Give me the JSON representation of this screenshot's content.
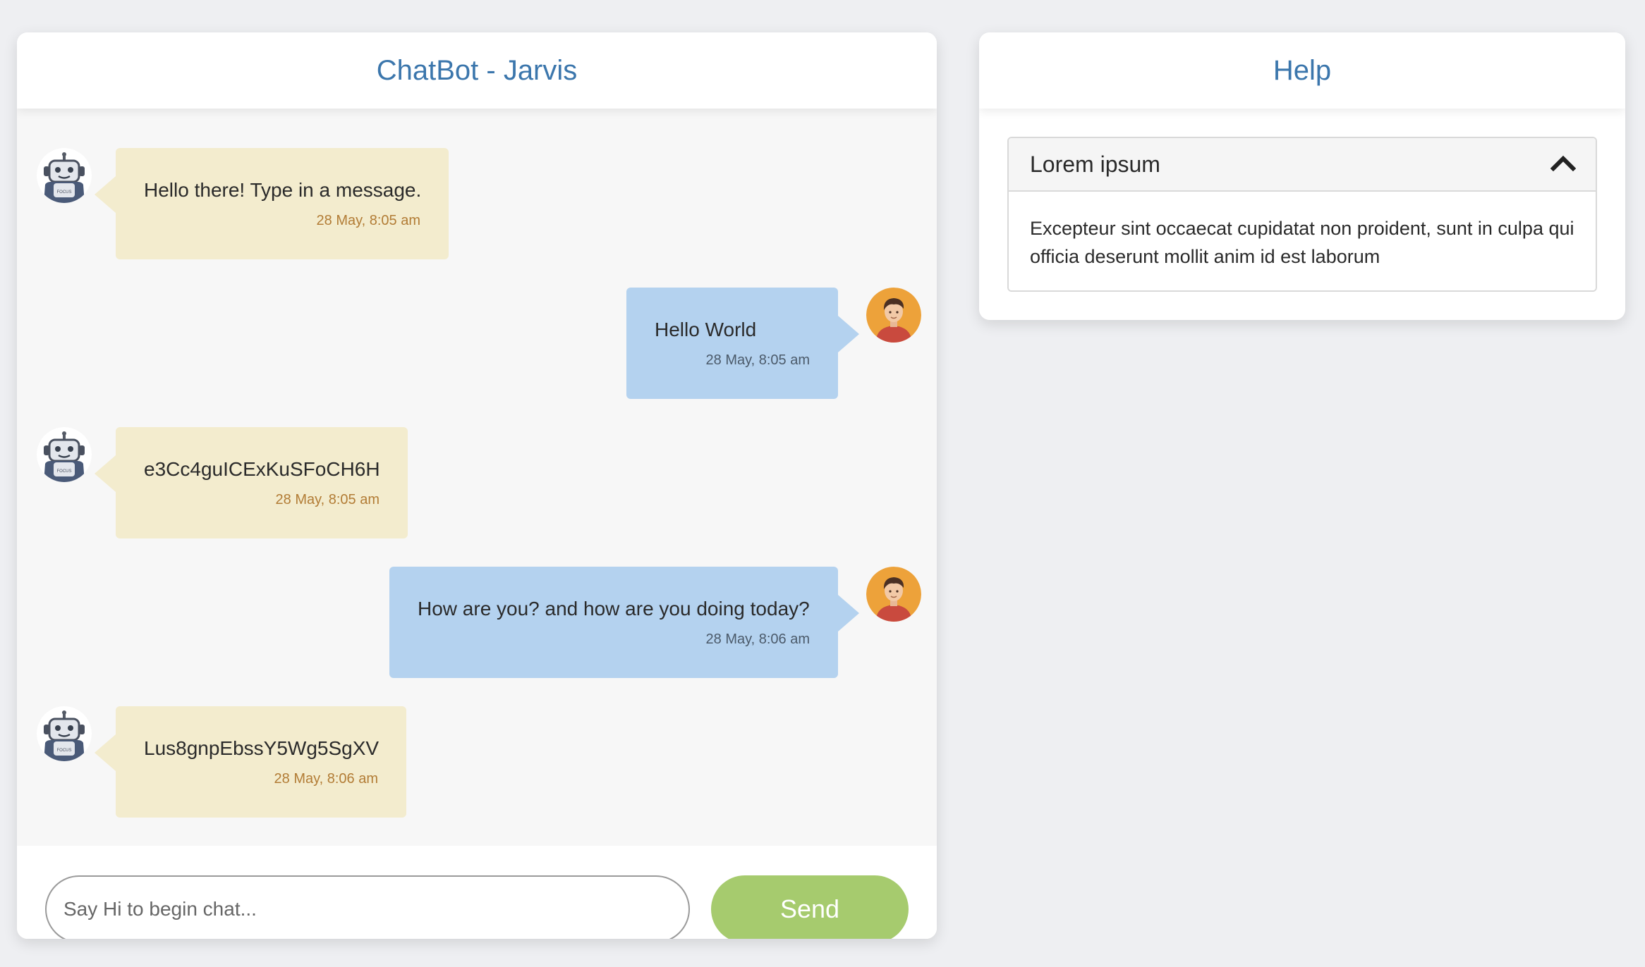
{
  "chat": {
    "title": "ChatBot - Jarvis",
    "messages": [
      {
        "sender": "bot",
        "text": "Hello there! Type in a message.",
        "time": "28 May, 8:05 am"
      },
      {
        "sender": "user",
        "text": "Hello World",
        "time": "28 May, 8:05 am"
      },
      {
        "sender": "bot",
        "text": "e3Cc4guICExKuSFoCH6H",
        "time": "28 May, 8:05 am"
      },
      {
        "sender": "user",
        "text": "How are you? and how are you doing today?",
        "time": "28 May, 8:06 am"
      },
      {
        "sender": "bot",
        "text": "Lus8gnpEbssY5Wg5SgXV",
        "time": "28 May, 8:06 am"
      }
    ],
    "input_placeholder": "Say Hi to begin chat...",
    "input_value": "",
    "send_label": "Send"
  },
  "help": {
    "title": "Help",
    "accordion": {
      "title": "Lorem ipsum",
      "expanded": true,
      "content": "Excepteur sint occaecat cupidatat non proident, sunt in culpa qui officia deserunt mollit anim id est laborum"
    }
  },
  "colors": {
    "title": "#3b76ac",
    "bot_bubble": "#f3ecce",
    "user_bubble": "#b4d2ef",
    "send_button": "#a6cb6e",
    "user_avatar": "#eda23a"
  },
  "icons": {
    "bot_avatar": "robot-icon",
    "user_avatar": "user-avatar-icon",
    "accordion_toggle": "chevron-up-icon"
  }
}
